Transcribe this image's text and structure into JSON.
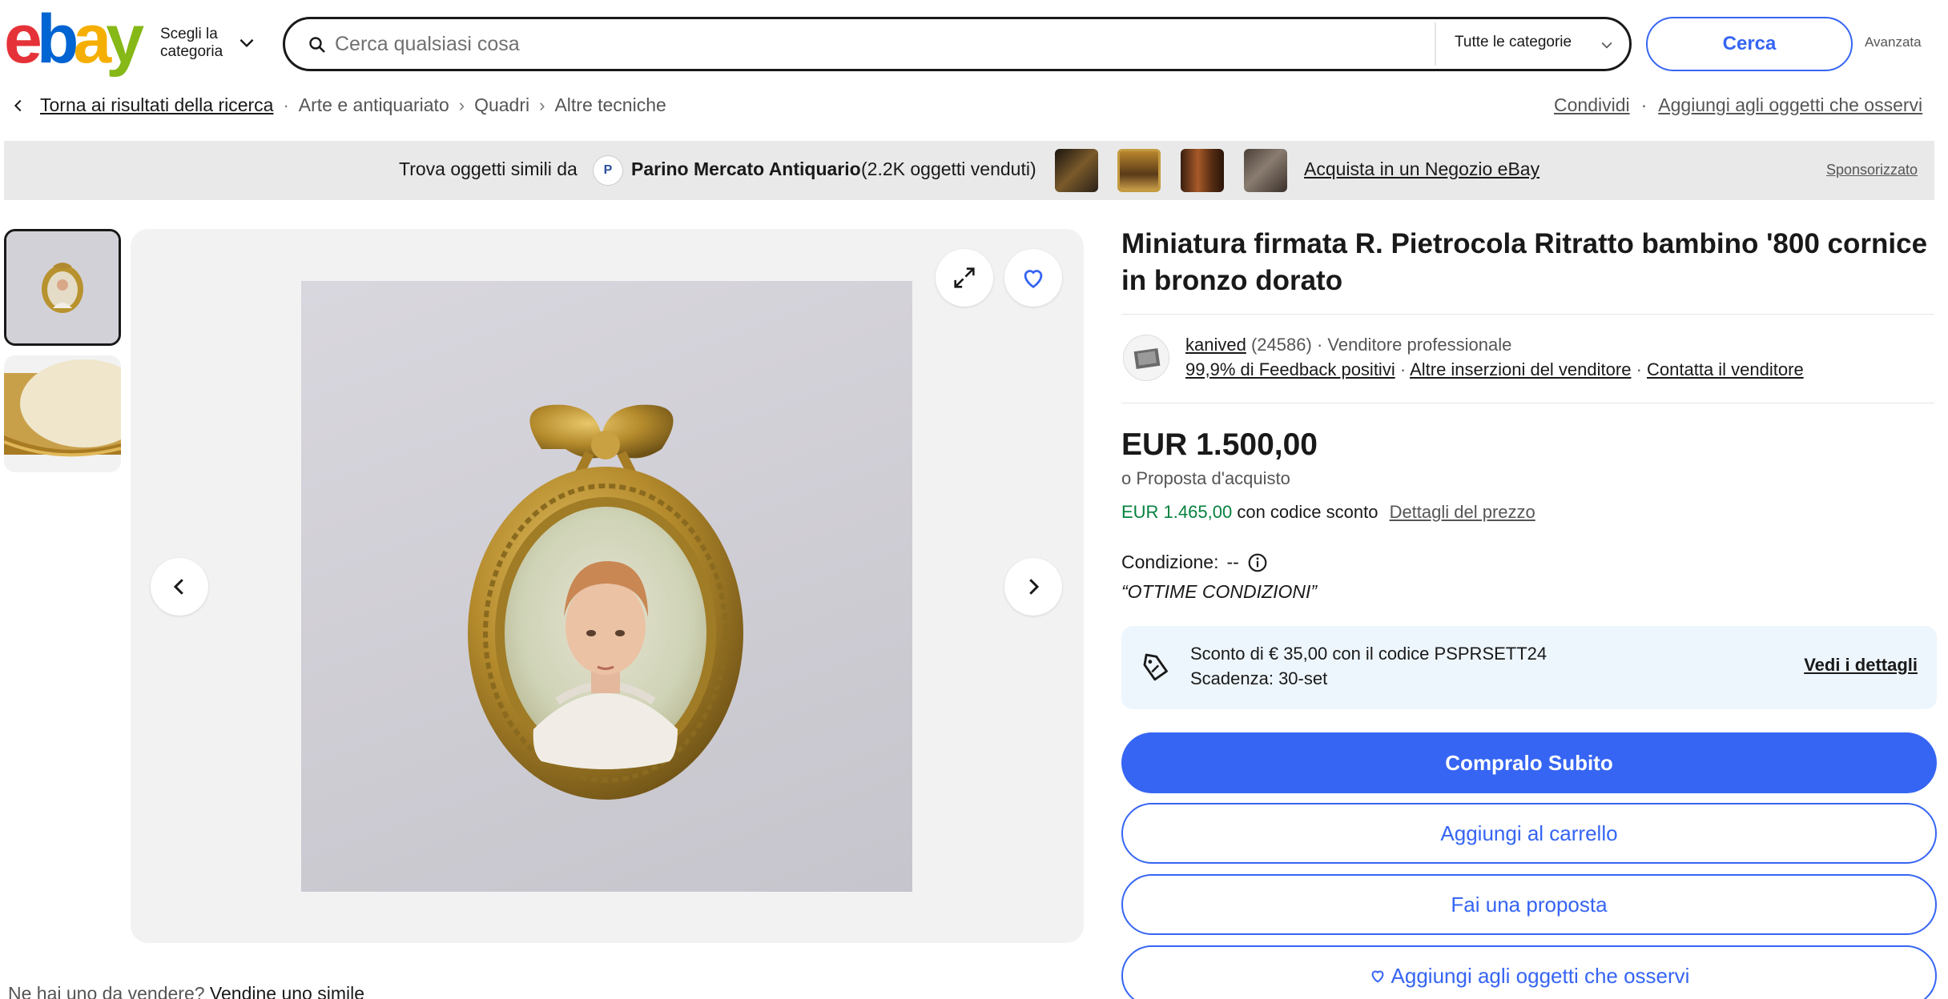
{
  "header": {
    "logo_letters": [
      {
        "ch": "e",
        "color": "#e53238"
      },
      {
        "ch": "b",
        "color": "#0064d2"
      },
      {
        "ch": "a",
        "color": "#f5af02"
      },
      {
        "ch": "y",
        "color": "#86b817"
      }
    ],
    "category_picker_line1": "Scegli la",
    "category_picker_line2": "categoria",
    "search_placeholder": "Cerca qualsiasi cosa",
    "all_categories": "Tutte le categorie",
    "search_button": "Cerca",
    "advanced": "Avanzata"
  },
  "breadcrumb": {
    "back": "Torna ai risultati della ricerca",
    "items": [
      "Arte e antiquariato",
      "Quadri",
      "Altre tecniche"
    ]
  },
  "top_actions": {
    "share": "Condividi",
    "watch": "Aggiungi agli oggetti che osservi"
  },
  "promo": {
    "intro": "Trova oggetti simili da",
    "store_name": "Parino Mercato Antiquario",
    "sold": "(2.2K oggetti venduti)",
    "shop_link": "Acquista in un Negozio eBay",
    "sponsored": "Sponsorizzato"
  },
  "listing": {
    "title": "Miniatura firmata R. Pietrocola Ritratto bambino '800 cornice in bronzo dorato",
    "seller": {
      "name": "kanived",
      "score": "(24586)",
      "type": "Venditore professionale",
      "feedback": "99,9% di Feedback positivi",
      "other_listings": "Altre inserzioni del venditore",
      "contact": "Contatta il venditore"
    },
    "price": "EUR 1.500,00",
    "best_offer": "o Proposta d'acquisto",
    "coupon_price": "EUR 1.465,00",
    "coupon_text": "con codice sconto",
    "price_details": "Dettagli del prezzo",
    "condition_label": "Condizione:",
    "condition_value": "--",
    "condition_quote": "“OTTIME CONDIZIONI”",
    "coupon_box": {
      "line1": "Sconto di € 35,00 con il codice PSPRSETT24",
      "line2": "Scadenza: 30-set",
      "details": "Vedi i dettagli"
    },
    "buttons": {
      "buy_now": "Compralo Subito",
      "add_to_cart": "Aggiungi al carrello",
      "make_offer": "Fai una proposta",
      "watch": "Aggiungi agli oggetti che osservi"
    }
  },
  "sell_note": {
    "text": "Ne hai uno da vendere?",
    "link": "Vendine uno simile"
  },
  "colors": {
    "accent_blue": "#3665f3",
    "coupon_green": "#05823f",
    "coupon_bg": "#eef6fd"
  }
}
